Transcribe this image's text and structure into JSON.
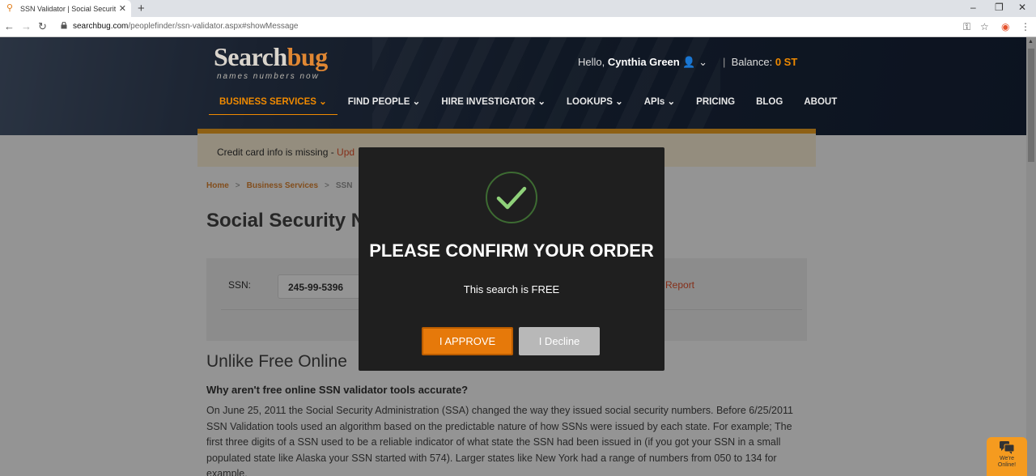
{
  "browser": {
    "tab_title": "SSN Validator | Social Security Nu",
    "url_host": "searchbug.com",
    "url_path": "/peoplefinder/ssn-validator.aspx#showMessage"
  },
  "header": {
    "logo_main": "Search",
    "logo_accent": "bug",
    "tagline": "names  numbers  now",
    "hello_prefix": "Hello,",
    "user_name": "Cynthia Green",
    "balance_label": "Balance:",
    "balance_value": "0 ST"
  },
  "nav": {
    "items": [
      {
        "label": "BUSINESS SERVICES"
      },
      {
        "label": "FIND PEOPLE"
      },
      {
        "label": "HIRE INVESTIGATOR"
      },
      {
        "label": "LOOKUPS"
      },
      {
        "label": "APIs"
      },
      {
        "label": "PRICING"
      },
      {
        "label": "BLOG"
      },
      {
        "label": "ABOUT"
      }
    ]
  },
  "alert": {
    "text": "Credit card info is missing - ",
    "link": "Upd"
  },
  "breadcrumb": {
    "home": "Home",
    "business": "Business Services",
    "current": "SSN"
  },
  "main": {
    "title": "Social Security Nu",
    "ssn_label": "SSN:",
    "ssn_value": "245-99-5396",
    "report_link": "Report",
    "section_heading": "Unlike Free Online",
    "question": "Why aren't free online SSN validator tools accurate?",
    "paragraph": "On June 25, 2011 the Social Security Administration (SSA) changed the way they issued social security numbers. Before 6/25/2011 SSN Validation tools used an algorithm based on the predictable nature of how SSNs were issued by each state. For example; The first three digits of a SSN used to be a reliable indicator of what state the SSN had been issued in (if you got your SSN in a small populated state like Alaska your SSN started with 574). Larger states like New York had a range of numbers from 050 to 134 for example."
  },
  "modal": {
    "title": "PLEASE CONFIRM YOUR ORDER",
    "subtitle": "This search is FREE",
    "approve_label": "I APPROVE",
    "decline_label": "I Decline"
  },
  "chat": {
    "line1": "We're",
    "line2": "Online!"
  },
  "colors": {
    "accent": "#f08a00",
    "approve": "#e6790a",
    "decline": "#b8b8b8",
    "check": "#8fd17a"
  }
}
